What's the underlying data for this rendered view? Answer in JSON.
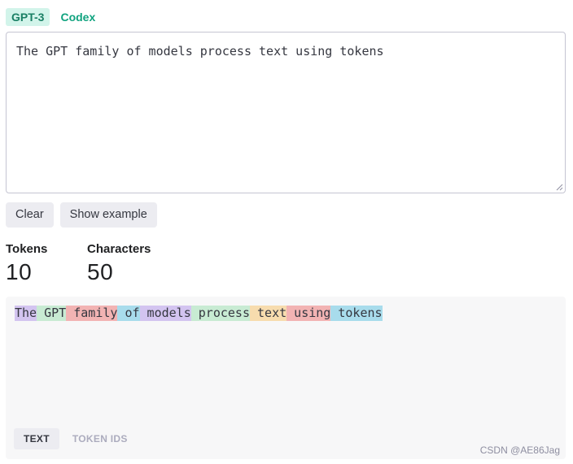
{
  "model_tabs": [
    {
      "label": "GPT-3",
      "active": true
    },
    {
      "label": "Codex",
      "active": false
    }
  ],
  "prompt": {
    "value": "The GPT family of models process text using tokens"
  },
  "buttons": {
    "clear": "Clear",
    "show_example": "Show example"
  },
  "stats": {
    "tokens_label": "Tokens",
    "tokens_value": "10",
    "characters_label": "Characters",
    "characters_value": "50"
  },
  "tokens": [
    {
      "text": "The",
      "color": "#d3c4f0"
    },
    {
      "text": " GPT",
      "color": "#c8ebd3"
    },
    {
      "text": " family",
      "color": "#f2b3b3"
    },
    {
      "text": " of",
      "color": "#a8dcec"
    },
    {
      "text": " models",
      "color": "#d3c4f0"
    },
    {
      "text": " process",
      "color": "#c8ebd3"
    },
    {
      "text": " text",
      "color": "#f7dcae"
    },
    {
      "text": " using",
      "color": "#f2b3b3"
    },
    {
      "text": " tokens",
      "color": "#a8dcec"
    }
  ],
  "view_tabs": {
    "text": "TEXT",
    "token_ids": "TOKEN IDS"
  },
  "watermark": "CSDN @AE86Jag"
}
